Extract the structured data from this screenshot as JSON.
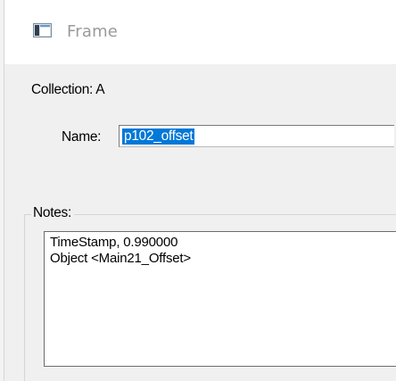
{
  "window": {
    "title": "Frame",
    "icon": "frame-window-icon"
  },
  "collection": {
    "label": "Collection: A"
  },
  "name_field": {
    "label": "Name:",
    "value": "p102_offset"
  },
  "notes": {
    "label": "Notes:",
    "lines": [
      "TimeStamp, 0.990000",
      "Object <Main21_Offset>"
    ]
  },
  "colors": {
    "selection": "#0078d7",
    "title_text": "#9a9a9a",
    "dialog_background": "#f0f0f0"
  }
}
